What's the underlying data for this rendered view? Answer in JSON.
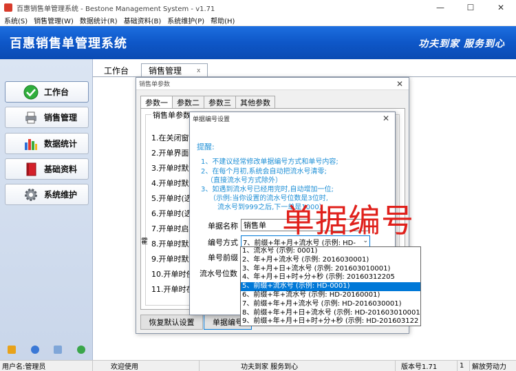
{
  "window": {
    "title": "百惠销售单管理系统 - Bestone Management System - v1.71",
    "controls": {
      "minimize": "—",
      "maximize": "☐",
      "close": "✕"
    }
  },
  "menu": [
    "系统(S)",
    "销售管理(W)",
    "数据统计(R)",
    "基础资料(B)",
    "系统维护(P)",
    "帮助(H)"
  ],
  "banner": {
    "title": "百惠销售单管理系统",
    "slogan": "功夫到家 服务到心"
  },
  "sidebar": {
    "items": [
      {
        "label": "工作台",
        "icon": "check-icon"
      },
      {
        "label": "销售管理",
        "icon": "printer-icon"
      },
      {
        "label": "数据统计",
        "icon": "bar-chart-icon"
      },
      {
        "label": "基础资料",
        "icon": "book-icon"
      },
      {
        "label": "系统维护",
        "icon": "gear-icon"
      }
    ]
  },
  "main_tabs": {
    "home": "工作台",
    "active": "销售管理",
    "close": "x"
  },
  "dialog1": {
    "title": "销售单参数",
    "close": "✕",
    "tabs": [
      "参数一",
      "参数二",
      "参数三",
      "其他参数"
    ],
    "group_caption": "销售单参数",
    "items": [
      "1.在关闭窗口",
      "2.开单界面表",
      "3.开单时默认",
      "4.开单时默认",
      "5.开单时(选",
      "6.开单时(选",
      "7.开单时启用",
      "8.开单时默认",
      "9.开单时默认",
      "10.开单时使",
      "11.开单时在"
    ],
    "stray_char": "霍",
    "buttons": {
      "reset": "恢复默认设置",
      "numbering": "单据编号"
    }
  },
  "dialog2": {
    "title": "单据编号设置",
    "close": "✕",
    "tip_head": "提醒:",
    "tips": [
      "1、不建议经常修改单据编号方式和单号内容;",
      "2、在每个月初,系统会自动把流水号清零;",
      "（直接流水号方式除外）",
      "3、如遇到流水号已经用完时,自动增加一位;",
      "（示例:当你设置的流水号位数是3位时,",
      "流水号到999之后,下一单是1000）"
    ],
    "fields": {
      "name_label": "单据名称",
      "name_value": "销售单",
      "mode_label": "编号方式",
      "mode_value": "7、前缀+年+月+流水号 (示例: HD-",
      "prefix_label": "单号前缀",
      "digits_label": "流水号位数"
    },
    "dropdown_options": [
      "1、流水号 (示例: 0001)",
      "2、年+月+流水号 (示例: 2016030001)",
      "3、年+月+日+流水号 (示例: 201603010001)",
      "4、年+月+日+时+分+秒 (示例: 20160312205",
      "5、前缀+流水号 (示例: HD-0001)",
      "6、前缀+年+流水号 (示例: HD-20160001)",
      "7、前缀+年+月+流水号 (示例: HD-2016030001)",
      "8、前缀+年+月+日+流水号 (示例: HD-201603010001",
      "9、前缀+年+月+日+时+分+秒 (示例: HD-201603122"
    ],
    "highlighted_index": 4
  },
  "overlay_text": "单据编号",
  "statusbar": {
    "user": "用户名:管理员",
    "welcome": "欢迎使用",
    "slogan": "功夫到家 服务到心",
    "version": "版本号1.71",
    "count": "1",
    "extra": "解放劳动力"
  },
  "colors": {
    "banner_blue": "#0e57c8",
    "highlight": "#0078d7",
    "tip_blue": "#1e8fd6",
    "overlay_red": "#e0201b"
  }
}
